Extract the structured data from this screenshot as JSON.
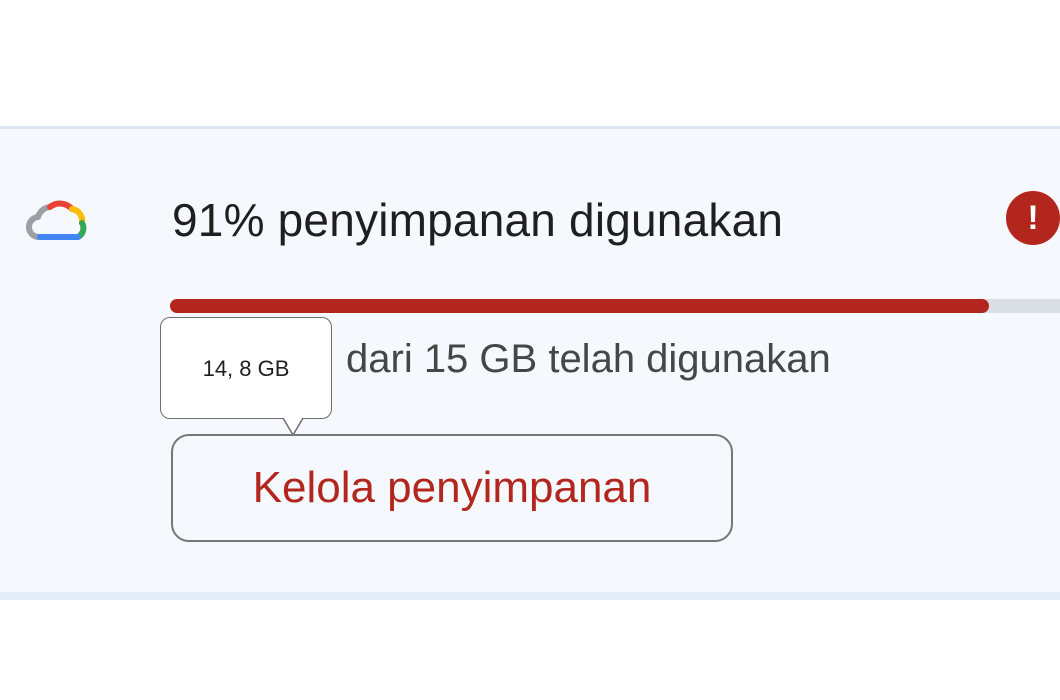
{
  "storage": {
    "title": "91% penyimpanan digunakan",
    "used_fraction": 0.91,
    "usage_text": "dari 15 GB telah digunakan",
    "tooltip_value": "14, 8 GB",
    "manage_button_label": "Kelola penyimpanan",
    "alert_glyph": "!"
  },
  "icons": {
    "cloud": "google-cloud-icon",
    "alert": "exclamation-alert-icon"
  },
  "colors": {
    "accent_red": "#b3261e",
    "track_gray": "#dadfe4",
    "card_background": "#f5f8fd",
    "cloud_blue": "#4285f4",
    "cloud_red": "#ea4335",
    "cloud_yellow": "#fbbc04",
    "cloud_green": "#34a853",
    "cloud_gray": "#9aa0a6"
  }
}
